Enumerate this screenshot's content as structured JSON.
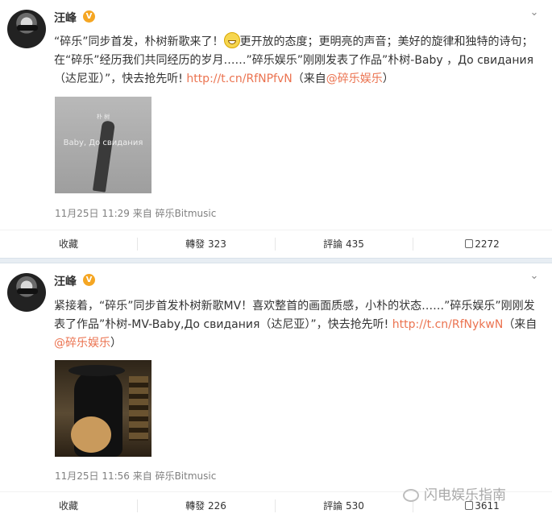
{
  "posts": [
    {
      "author": "汪峰",
      "verified_badge": "V",
      "text_parts": [
        {
          "t": "“碎乐”同步首发，朴树新歌来了！"
        },
        {
          "t": "更开放的态度；更明亮的声音；美好的旋律和独特的诗句；在“碎乐”经历我们共同经历的岁月……"
        },
        {
          "t": "”碎乐娱乐”刚刚发表了作品”朴树-Baby ，До свидания（达尼亚）”，快去抢先听! "
        },
        {
          "t": "http://t.cn/RfNPfvN",
          "link": true
        },
        {
          "t": "（来自"
        },
        {
          "t": "@碎乐娱乐",
          "link": true
        },
        {
          "t": "）"
        }
      ],
      "image": {
        "title": "Baby, До свидания",
        "subtitle": "朴 树"
      },
      "meta": "11月25日 11:29 来自 碎乐Bitmusic",
      "actions": {
        "collect": "收藏",
        "repost": "轉發 323",
        "comment": "評論 435",
        "like": "2272"
      }
    },
    {
      "author": "汪峰",
      "verified_badge": "V",
      "text_parts": [
        {
          "t": "紧接着，“碎乐”同步首发朴树新歌MV！喜欢整首的画面质感，小朴的状态……”碎乐娱乐”刚刚发表了作品”朴树-MV-Baby,До свидания（达尼亚）”，快去抢先听! "
        },
        {
          "t": "http://t.cn/RfNykwN",
          "link": true
        },
        {
          "t": "（来自"
        },
        {
          "t": "@碎乐娱乐",
          "link": true
        },
        {
          "t": "）"
        }
      ],
      "meta": "11月25日 11:56 来自 碎乐Bitmusic",
      "actions": {
        "collect": "收藏",
        "repost": "轉發 226",
        "comment": "評論 530",
        "like": "3611"
      }
    }
  ],
  "watermark": "闪电娱乐指南",
  "colors": {
    "link": "#eb7350",
    "text": "#333333",
    "meta": "#808080",
    "separator": "#e7edf3",
    "badge": "#f5a623"
  },
  "icons": {
    "chevron": "chevron-down-icon",
    "like": "thumbs-up-icon",
    "emoji": "grin-emoji-icon"
  }
}
